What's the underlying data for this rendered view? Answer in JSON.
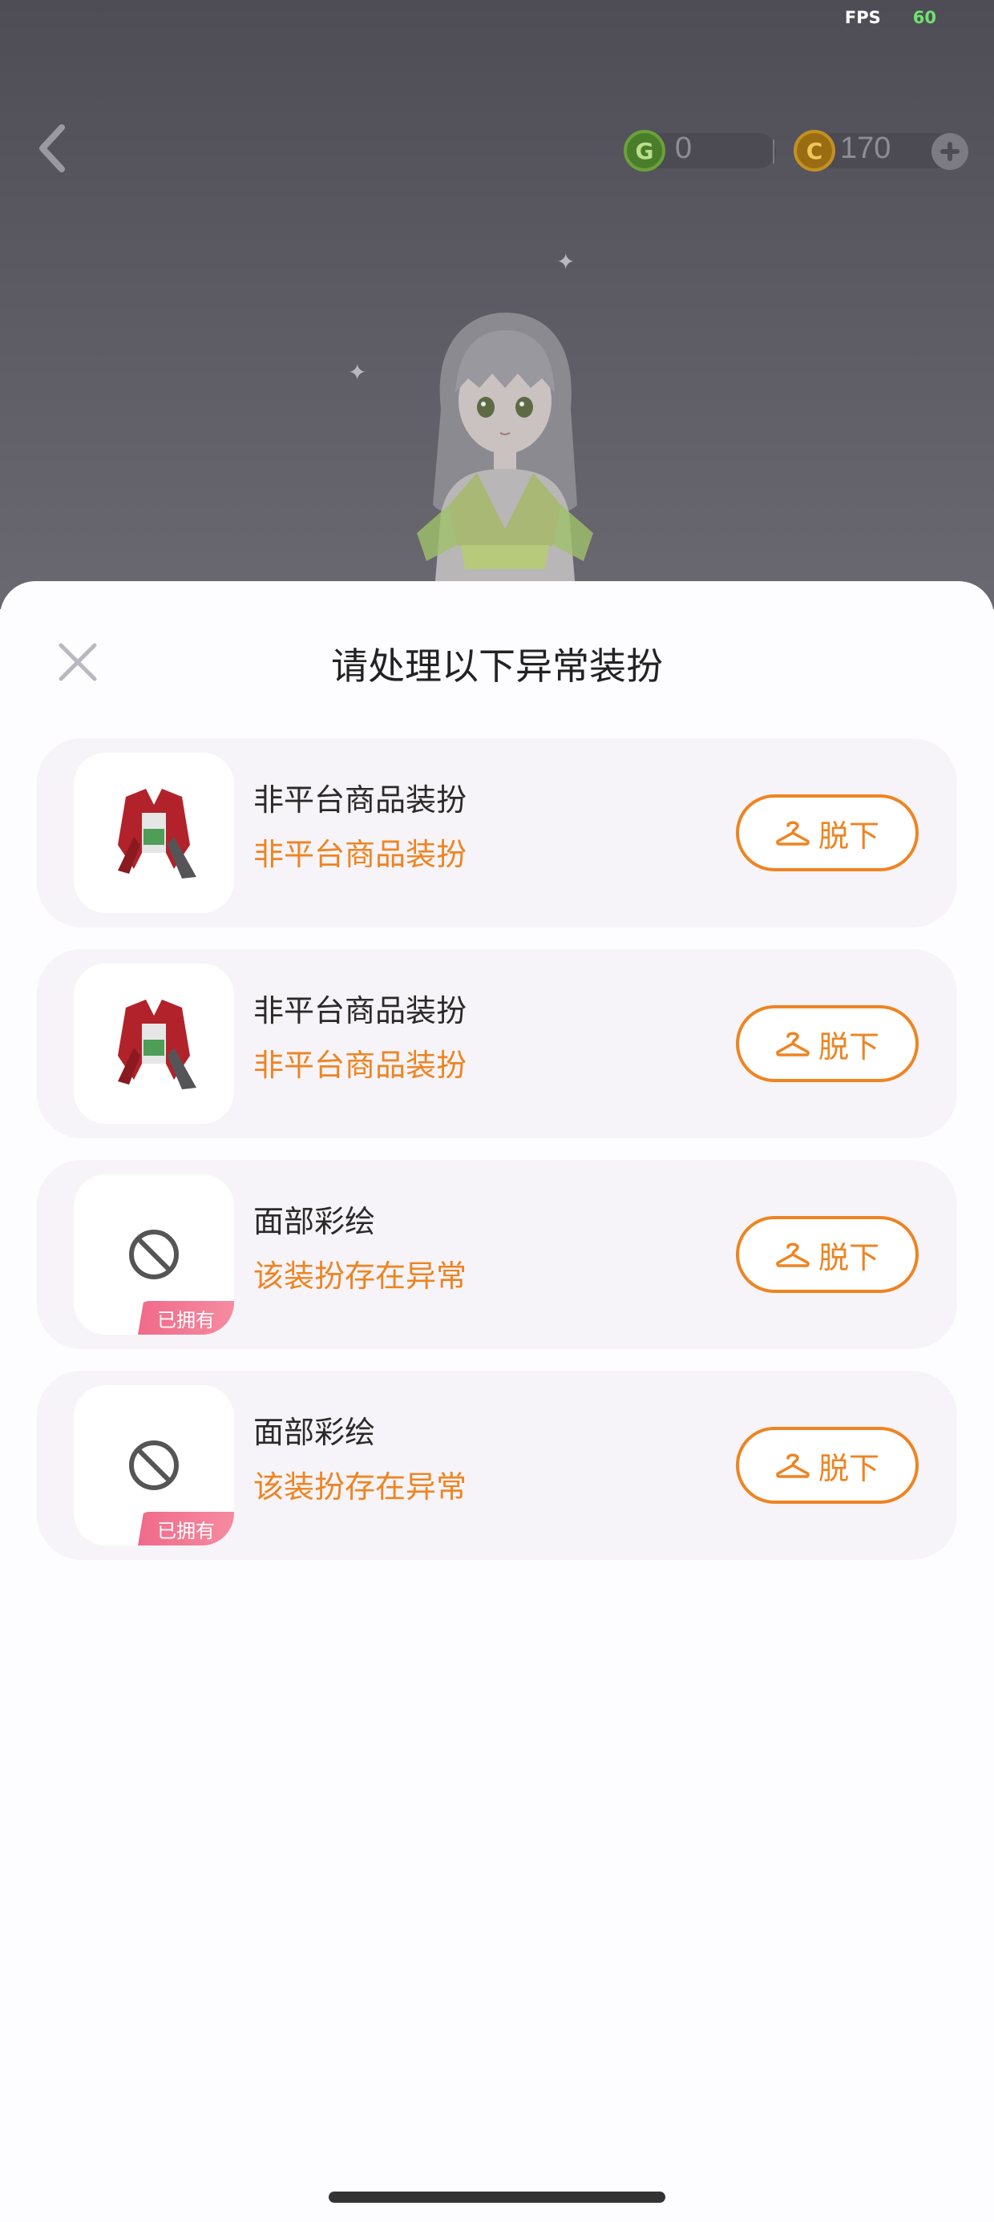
{
  "status": {
    "fps_label": "FPS",
    "fps_value": "60"
  },
  "header": {
    "back_icon": "chevron-left-icon",
    "currency": [
      {
        "icon": "green-coin-icon",
        "value": "0"
      },
      {
        "icon": "gold-coin-icon",
        "value": "170"
      }
    ],
    "add_icon": "plus-circle-icon"
  },
  "dialog": {
    "title": "请处理以下异常装扮",
    "close_icon": "close-icon",
    "items": [
      {
        "name": "非平台商品装扮",
        "status": "非平台商品装扮",
        "thumb": "outfit-thumbnail",
        "badge": "",
        "action_label": "脱下",
        "action_icon": "hanger-icon"
      },
      {
        "name": "非平台商品装扮",
        "status": "非平台商品装扮",
        "thumb": "outfit-thumbnail",
        "badge": "",
        "action_label": "脱下",
        "action_icon": "hanger-icon"
      },
      {
        "name": "面部彩绘",
        "status": "该装扮存在异常",
        "thumb": "prohibited-icon",
        "badge": "已拥有",
        "action_label": "脱下",
        "action_icon": "hanger-icon"
      },
      {
        "name": "面部彩绘",
        "status": "该装扮存在异常",
        "thumb": "prohibited-icon",
        "badge": "已拥有",
        "action_label": "脱下",
        "action_icon": "hanger-icon"
      }
    ]
  },
  "colors": {
    "accent": "#ee8421",
    "badge": "#f06a8a",
    "scene_bg": "#5b5961"
  }
}
